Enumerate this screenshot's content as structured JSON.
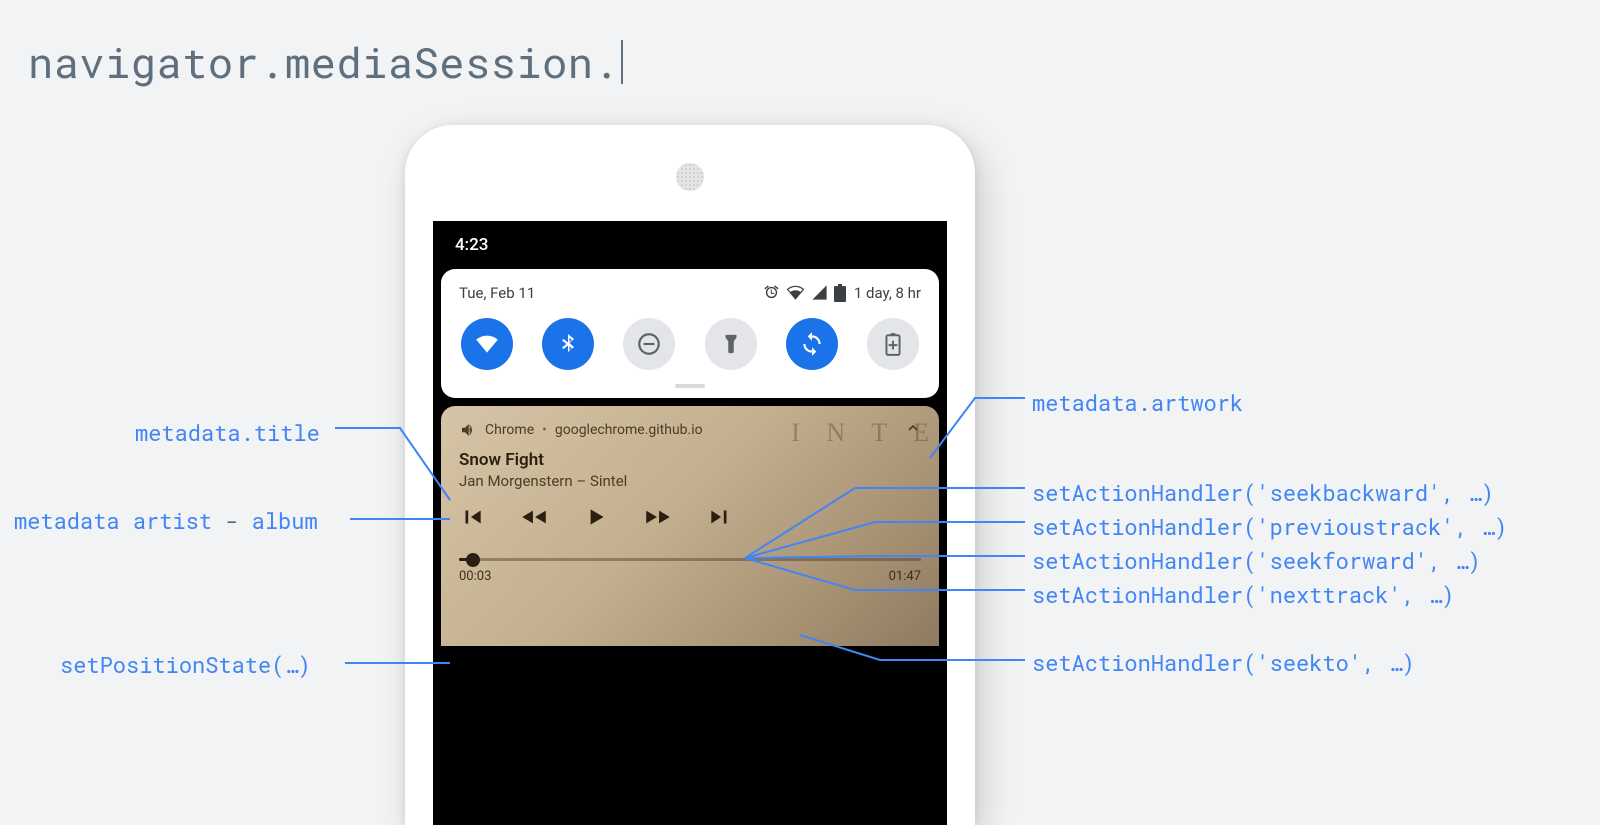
{
  "heading": "navigator.mediaSession.",
  "statusbar": {
    "time": "4:23"
  },
  "quickSettings": {
    "date": "Tue, Feb 11",
    "duration": "1 day, 8 hr"
  },
  "media": {
    "appSource": "Chrome",
    "domain": "googlechrome.github.io",
    "title": "Snow Fight",
    "subtitle": "Jan Morgenstern – Sintel",
    "elapsed": "00:03",
    "total": "01:47"
  },
  "annotations": {
    "left": {
      "title": "metadata.title",
      "artistAlbum_pre": "metadata artist",
      "artistAlbum_dash": " - ",
      "artistAlbum_post": "album",
      "position": "setPositionState(…)"
    },
    "right": {
      "artwork": "metadata.artwork",
      "seekbackward": "setActionHandler('seekbackward', …)",
      "previoustrack": "setActionHandler('previoustrack', …)",
      "seekforward": "setActionHandler('seekforward', …)",
      "nexttrack": "setActionHandler('nexttrack', …)",
      "seekto": "setActionHandler('seekto', …)"
    }
  }
}
